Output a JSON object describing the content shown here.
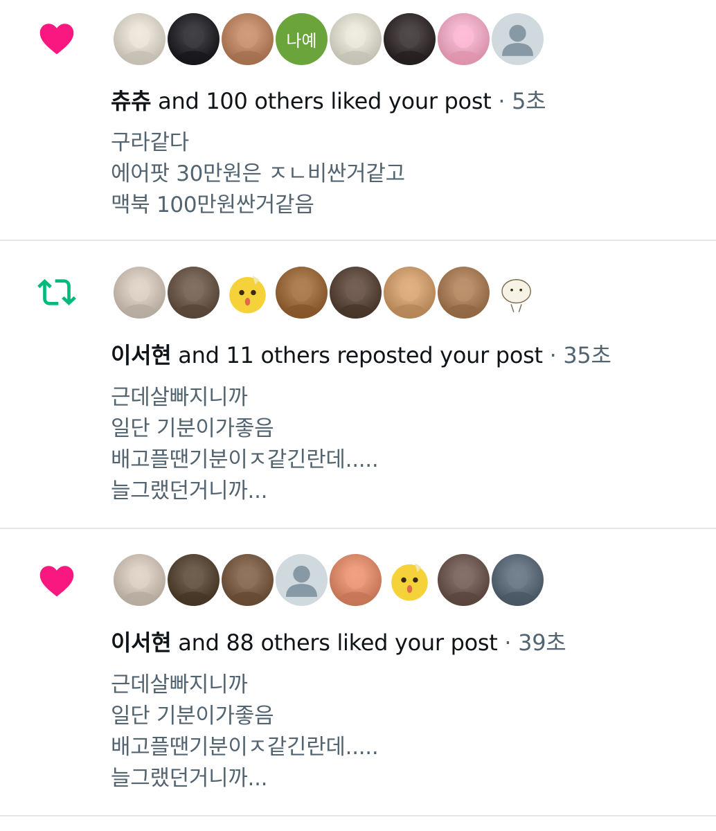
{
  "notifications": [
    {
      "type": "like",
      "icon": "heart-icon",
      "icon_color": "#f91880",
      "avatars": [
        {
          "kind": "photo",
          "color": "#d9d2c7"
        },
        {
          "kind": "photo",
          "color": "#2b2b2f"
        },
        {
          "kind": "photo",
          "color": "#b88463"
        },
        {
          "kind": "text",
          "text": "나예",
          "color": "#6aa43a"
        },
        {
          "kind": "photo",
          "color": "#d7d6c8"
        },
        {
          "kind": "photo",
          "color": "#3a3333"
        },
        {
          "kind": "photo",
          "color": "#f2a7c0"
        },
        {
          "kind": "default",
          "color": "#cfd9de"
        }
      ],
      "name": "츄츄",
      "action": " and 100 others liked your post",
      "separator": " · ",
      "time": "5초",
      "lines": [
        "구라같다",
        "에어팟 30만원은 ㅈㄴ비싼거같고",
        "맥북 100만원싼거같음"
      ]
    },
    {
      "type": "repost",
      "icon": "repost-icon",
      "icon_color": "#00ba7c",
      "avatars": [
        {
          "kind": "photo",
          "color": "#cbbfb4"
        },
        {
          "kind": "photo",
          "color": "#6b5a4c"
        },
        {
          "kind": "emoji",
          "color": "#f6d23a"
        },
        {
          "kind": "photo",
          "color": "#9a6a3f"
        },
        {
          "kind": "photo",
          "color": "#5d4a3f"
        },
        {
          "kind": "photo",
          "color": "#c99a6b"
        },
        {
          "kind": "photo",
          "color": "#a57c57"
        },
        {
          "kind": "drawing",
          "color": "#f7f2e6"
        }
      ],
      "name": "이서현",
      "action": " and 11 others reposted your post",
      "separator": " · ",
      "time": "35초",
      "lines": [
        "근데살빠지니까",
        "일단 기분이가좋음",
        "배고플땐기분이ㅈ같긴란데.....",
        "늘그랬던거니까..."
      ]
    },
    {
      "type": "like",
      "icon": "heart-icon",
      "icon_color": "#f91880",
      "avatars": [
        {
          "kind": "photo",
          "color": "#cbbfb4"
        },
        {
          "kind": "photo",
          "color": "#5a4a3a"
        },
        {
          "kind": "photo",
          "color": "#7a5e48"
        },
        {
          "kind": "default",
          "color": "#cfd9de"
        },
        {
          "kind": "photo",
          "color": "#d98a6a"
        },
        {
          "kind": "emoji",
          "color": "#f6d23a"
        },
        {
          "kind": "photo",
          "color": "#6e5a52"
        },
        {
          "kind": "photo",
          "color": "#5e6b78"
        }
      ],
      "name": "이서현",
      "action": " and 88 others liked your post",
      "separator": " · ",
      "time": "39초",
      "lines": [
        "근데살빠지니까",
        "일단 기분이가좋음",
        "배고플땐기분이ㅈ같긴란데.....",
        "늘그랬던거니까..."
      ]
    }
  ]
}
